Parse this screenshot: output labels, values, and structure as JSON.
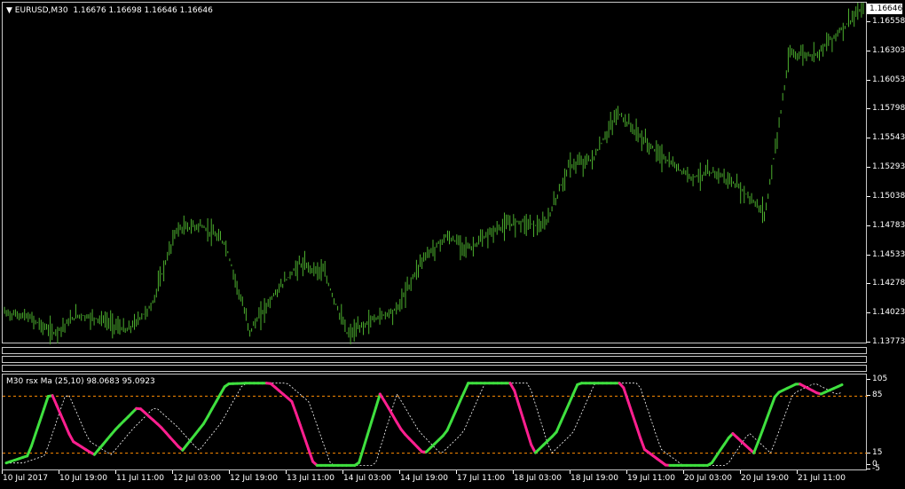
{
  "main": {
    "symbol": "EURUSD,M30",
    "ohlc": "1.16676 1.16698 1.16646 1.16646",
    "current_price": "1.16646",
    "price_labels": [
      "1.16558",
      "1.16303",
      "1.16053",
      "1.15798",
      "1.15543",
      "1.15293",
      "1.15038",
      "1.14783",
      "1.14533",
      "1.14278",
      "1.14023",
      "1.13773"
    ]
  },
  "indicator": {
    "title": "M30 rsx Ma (25,10)",
    "value1": "98.0683",
    "value2": "95.0923",
    "level_labels": [
      "105",
      "85",
      "15",
      "0",
      "-5"
    ]
  },
  "time_labels": [
    "10 Jul 2017",
    "10 Jul 19:00",
    "11 Jul 11:00",
    "12 Jul 03:00",
    "12 Jul 19:00",
    "13 Jul 11:00",
    "14 Jul 03:00",
    "14 Jul 19:00",
    "17 Jul 11:00",
    "18 Jul 03:00",
    "18 Jul 19:00",
    "19 Jul 11:00",
    "20 Jul 03:00",
    "20 Jul 19:00",
    "21 Jul 11:00"
  ],
  "colors": {
    "candles": "#4caf2e",
    "rsx_up": "#3fe03f",
    "rsx_down": "#ff1f8f",
    "signal": "#ffffff",
    "level": "#ff8c00"
  },
  "chart_data": [
    {
      "type": "line",
      "title": "EURUSD,M30",
      "series": [
        {
          "name": "EURUSD,M30",
          "values": [
            1.1402,
            1.1398,
            1.1384,
            1.14,
            1.1396,
            1.1386,
            1.1408,
            1.1474,
            1.1478,
            1.1462,
            1.1386,
            1.1418,
            1.1444,
            1.1438,
            1.1382,
            1.1396,
            1.1405,
            1.1448,
            1.1468,
            1.1458,
            1.1474,
            1.1482,
            1.1476,
            1.1529,
            1.1536,
            1.1576,
            1.1553,
            1.1534,
            1.152,
            1.1524,
            1.151,
            1.1488,
            1.1627,
            1.1626,
            1.1646,
            1.1667
          ]
        }
      ],
      "ylim": [
        1.1376,
        1.167
      ]
    },
    {
      "type": "line",
      "title": "M30 rsx Ma (25,10)",
      "series": [
        {
          "name": "rsx",
          "values": [
            3,
            12,
            92,
            30,
            13,
            45,
            72,
            48,
            18,
            52,
            100,
            101,
            101,
            78,
            0,
            0,
            0,
            88,
            42,
            14,
            40,
            101,
            101,
            101,
            14,
            40,
            101,
            101,
            101,
            20,
            0,
            0,
            0,
            40,
            15,
            88,
            101,
            87,
            99
          ]
        }
      ],
      "levels": [
        85,
        15
      ],
      "ylim": [
        -5,
        105
      ]
    }
  ]
}
